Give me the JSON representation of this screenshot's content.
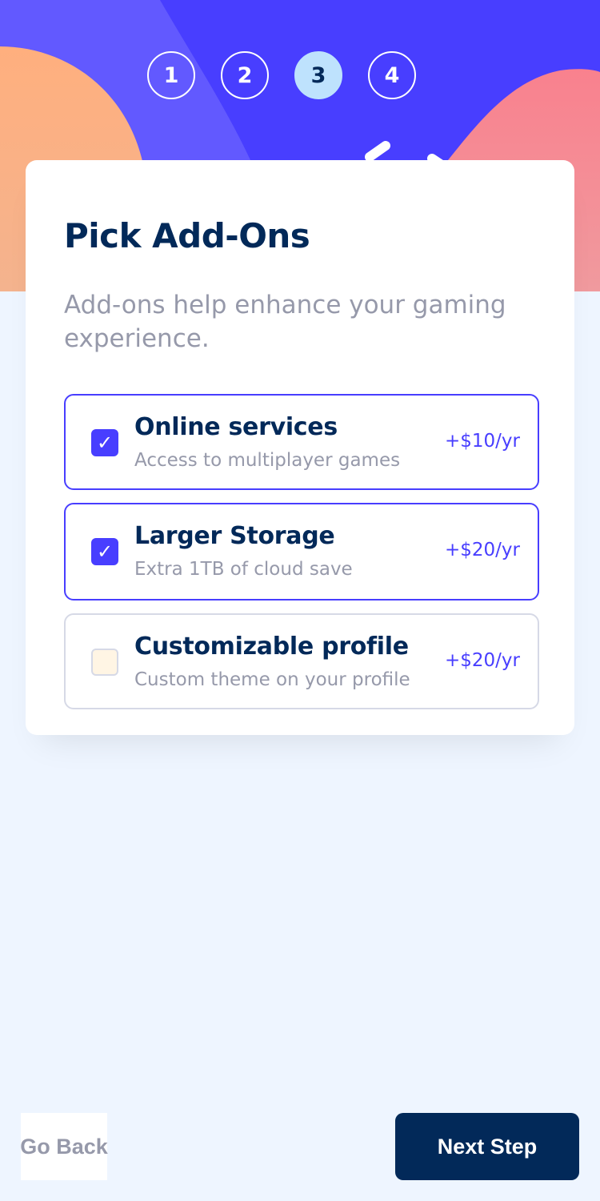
{
  "stepper": {
    "steps": [
      "1",
      "2",
      "3",
      "4"
    ],
    "active_step": "3"
  },
  "form": {
    "title": "Pick Add-Ons",
    "subtitle": "Add-ons help enhance your gaming experience.",
    "addons": [
      {
        "name": "Online services",
        "description": "Access to multiplayer games",
        "price": "+$10/yr",
        "checked": true,
        "check_glyph": "✓"
      },
      {
        "name": "Larger Storage",
        "description": "Extra 1TB of cloud save",
        "price": "+$20/yr",
        "checked": true,
        "check_glyph": "✓"
      },
      {
        "name": "Customizable profile",
        "description": "Custom theme on your profile",
        "price": "+$20/yr",
        "checked": false,
        "check_glyph": ""
      }
    ]
  },
  "footer": {
    "back_label": "Go Back",
    "next_label": "Next Step"
  },
  "colors": {
    "marine_blue": "#022959",
    "purplish_blue": "#483eff",
    "light_blue": "#bee2fd",
    "grey": "#9699aa",
    "light_grey": "#d6d9e6",
    "magnolia": "#eef5ff",
    "alabaster": "#fff5e4"
  }
}
